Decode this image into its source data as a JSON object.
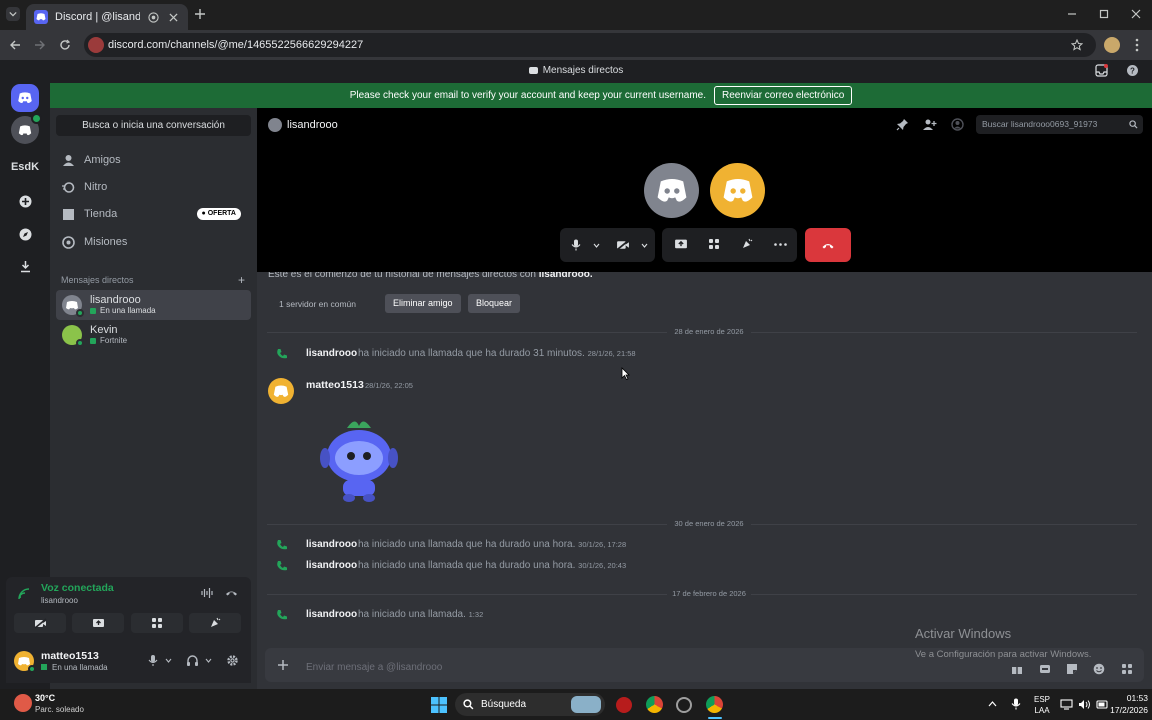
{
  "browser": {
    "tab_title": "Discord | @lisandrooo",
    "url": "discord.com/channels/@me/1465522566629294227"
  },
  "app": {
    "title": "Mensajes directos"
  },
  "banner": {
    "message": "Please check your email to verify your account and keep your current username.",
    "button": "Reenviar correo electrónico"
  },
  "rail": {
    "server_label": "EsdK"
  },
  "sidebar": {
    "search": "Busca o inicia una conversación",
    "nav": [
      {
        "label": "Amigos",
        "icon": "friends-icon"
      },
      {
        "label": "Nitro",
        "icon": "nitro-icon"
      },
      {
        "label": "Tienda",
        "icon": "shop-icon",
        "badge": "OFERTA"
      },
      {
        "label": "Misiones",
        "icon": "quests-icon"
      }
    ],
    "dm_header": "Mensajes directos",
    "dms": [
      {
        "name": "lisandrooo",
        "status": "En una llamada"
      },
      {
        "name": "Kevin",
        "status": "Fortnite"
      }
    ]
  },
  "voice": {
    "status": "Voz conectada",
    "channel": "lisandrooo"
  },
  "user": {
    "name": "matteo1513",
    "status": "En una llamada"
  },
  "chat": {
    "header_name": "lisandrooo",
    "search_placeholder": "Buscar lisandrooo0693_91973",
    "intro": "Este es el comienzo de tu historial de mensajes directos con",
    "intro_name": "lisandrooo.",
    "mutual": "1 servidor en común",
    "remove_friend": "Eliminar amigo",
    "block": "Bloquear",
    "date1": "28 de enero de 2026",
    "call1_user": "lisandrooo",
    "call1_text": "ha iniciado una llamada que ha durado 31 minutos.",
    "call1_time": "28/1/26, 21:58",
    "msg_author": "matteo1513",
    "msg_time": "28/1/26, 22:05",
    "date2": "30 de enero de 2026",
    "call2_user": "lisandrooo",
    "call2_text": "ha iniciado una llamada que ha durado una hora.",
    "call2_time": "30/1/26, 17:28",
    "call3_user": "lisandrooo",
    "call3_text": "ha iniciado una llamada que ha durado una hora.",
    "call3_time": "30/1/26, 20:43",
    "date3": "17 de febrero de 2026",
    "call4_user": "lisandrooo",
    "call4_text": "ha iniciado una llamada.",
    "call4_time": "1:32",
    "input_placeholder": "Enviar mensaje a @lisandrooo"
  },
  "watermark": {
    "title": "Activar Windows",
    "subtitle": "Ve a Configuración para activar Windows."
  },
  "taskbar": {
    "weather_temp": "30°C",
    "weather_desc": "Parc. soleado",
    "search": "Búsqueda",
    "lang1": "ESP",
    "lang2": "LAA",
    "time": "01:53",
    "date": "17/2/2026"
  },
  "colors": {
    "blurple": "#5865f2",
    "green": "#23a55a",
    "danger": "#da373c",
    "yellow_avatar": "#f0b232",
    "banner": "#1d6b36"
  }
}
